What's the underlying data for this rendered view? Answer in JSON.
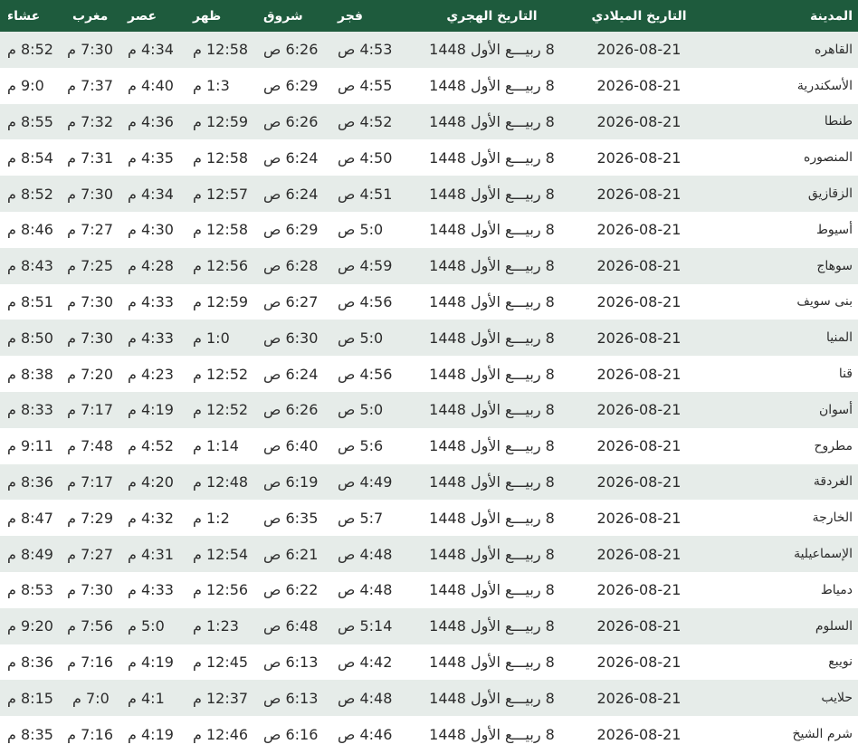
{
  "table": {
    "headers": {
      "city": "المدينة",
      "gregorian": "التاريخ الميلادي",
      "hijri": "التاريخ الهجري",
      "fajr": "فجر",
      "shuruq": "شروق",
      "dhuhr": "ظهر",
      "asr": "عصر",
      "maghrib": "مغرب",
      "isha": "عشاء"
    },
    "rows": [
      {
        "city": "القاهره",
        "gregorian": "2026-08-21",
        "hijri": "8 ربيـــع الأول 1448",
        "fajr": "4:53 ص",
        "shuruq": "6:26 ص",
        "dhuhr": "12:58 م",
        "asr": "4:34 م",
        "maghrib": "7:30 م",
        "isha": "8:52 م"
      },
      {
        "city": "الأسكندرية",
        "gregorian": "2026-08-21",
        "hijri": "8 ربيـــع الأول 1448",
        "fajr": "4:55 ص",
        "shuruq": "6:29 ص",
        "dhuhr": "1:3 م",
        "asr": "4:40 م",
        "maghrib": "7:37 م",
        "isha": "9:0 م"
      },
      {
        "city": "طنطا",
        "gregorian": "2026-08-21",
        "hijri": "8 ربيـــع الأول 1448",
        "fajr": "4:52 ص",
        "shuruq": "6:26 ص",
        "dhuhr": "12:59 م",
        "asr": "4:36 م",
        "maghrib": "7:32 م",
        "isha": "8:55 م"
      },
      {
        "city": "المنصوره",
        "gregorian": "2026-08-21",
        "hijri": "8 ربيـــع الأول 1448",
        "fajr": "4:50 ص",
        "shuruq": "6:24 ص",
        "dhuhr": "12:58 م",
        "asr": "4:35 م",
        "maghrib": "7:31 م",
        "isha": "8:54 م"
      },
      {
        "city": "الزقازيق",
        "gregorian": "2026-08-21",
        "hijri": "8 ربيـــع الأول 1448",
        "fajr": "4:51 ص",
        "shuruq": "6:24 ص",
        "dhuhr": "12:57 م",
        "asr": "4:34 م",
        "maghrib": "7:30 م",
        "isha": "8:52 م"
      },
      {
        "city": "أسيوط",
        "gregorian": "2026-08-21",
        "hijri": "8 ربيـــع الأول 1448",
        "fajr": "5:0 ص",
        "shuruq": "6:29 ص",
        "dhuhr": "12:58 م",
        "asr": "4:30 م",
        "maghrib": "7:27 م",
        "isha": "8:46 م"
      },
      {
        "city": "سوهاج",
        "gregorian": "2026-08-21",
        "hijri": "8 ربيـــع الأول 1448",
        "fajr": "4:59 ص",
        "shuruq": "6:28 ص",
        "dhuhr": "12:56 م",
        "asr": "4:28 م",
        "maghrib": "7:25 م",
        "isha": "8:43 م"
      },
      {
        "city": "بنى سويف",
        "gregorian": "2026-08-21",
        "hijri": "8 ربيـــع الأول 1448",
        "fajr": "4:56 ص",
        "shuruq": "6:27 ص",
        "dhuhr": "12:59 م",
        "asr": "4:33 م",
        "maghrib": "7:30 م",
        "isha": "8:51 م"
      },
      {
        "city": "المنيا",
        "gregorian": "2026-08-21",
        "hijri": "8 ربيـــع الأول 1448",
        "fajr": "5:0 ص",
        "shuruq": "6:30 ص",
        "dhuhr": "1:0 م",
        "asr": "4:33 م",
        "maghrib": "7:30 م",
        "isha": "8:50 م"
      },
      {
        "city": "قنا",
        "gregorian": "2026-08-21",
        "hijri": "8 ربيـــع الأول 1448",
        "fajr": "4:56 ص",
        "shuruq": "6:24 ص",
        "dhuhr": "12:52 م",
        "asr": "4:23 م",
        "maghrib": "7:20 م",
        "isha": "8:38 م"
      },
      {
        "city": "أسوان",
        "gregorian": "2026-08-21",
        "hijri": "8 ربيـــع الأول 1448",
        "fajr": "5:0 ص",
        "shuruq": "6:26 ص",
        "dhuhr": "12:52 م",
        "asr": "4:19 م",
        "maghrib": "7:17 م",
        "isha": "8:33 م"
      },
      {
        "city": "مطروح",
        "gregorian": "2026-08-21",
        "hijri": "8 ربيـــع الأول 1448",
        "fajr": "5:6 ص",
        "shuruq": "6:40 ص",
        "dhuhr": "1:14 م",
        "asr": "4:52 م",
        "maghrib": "7:48 م",
        "isha": "9:11 م"
      },
      {
        "city": "الغردقة",
        "gregorian": "2026-08-21",
        "hijri": "8 ربيـــع الأول 1448",
        "fajr": "4:49 ص",
        "shuruq": "6:19 ص",
        "dhuhr": "12:48 م",
        "asr": "4:20 م",
        "maghrib": "7:17 م",
        "isha": "8:36 م"
      },
      {
        "city": "الخارجة",
        "gregorian": "2026-08-21",
        "hijri": "8 ربيـــع الأول 1448",
        "fajr": "5:7 ص",
        "shuruq": "6:35 ص",
        "dhuhr": "1:2 م",
        "asr": "4:32 م",
        "maghrib": "7:29 م",
        "isha": "8:47 م"
      },
      {
        "city": "الإسماعيلية",
        "gregorian": "2026-08-21",
        "hijri": "8 ربيـــع الأول 1448",
        "fajr": "4:48 ص",
        "shuruq": "6:21 ص",
        "dhuhr": "12:54 م",
        "asr": "4:31 م",
        "maghrib": "7:27 م",
        "isha": "8:49 م"
      },
      {
        "city": "دمياط",
        "gregorian": "2026-08-21",
        "hijri": "8 ربيـــع الأول 1448",
        "fajr": "4:48 ص",
        "shuruq": "6:22 ص",
        "dhuhr": "12:56 م",
        "asr": "4:33 م",
        "maghrib": "7:30 م",
        "isha": "8:53 م"
      },
      {
        "city": "السلوم",
        "gregorian": "2026-08-21",
        "hijri": "8 ربيـــع الأول 1448",
        "fajr": "5:14 ص",
        "shuruq": "6:48 ص",
        "dhuhr": "1:23 م",
        "asr": "5:0 م",
        "maghrib": "7:56 م",
        "isha": "9:20 م"
      },
      {
        "city": "نويبع",
        "gregorian": "2026-08-21",
        "hijri": "8 ربيـــع الأول 1448",
        "fajr": "4:42 ص",
        "shuruq": "6:13 ص",
        "dhuhr": "12:45 م",
        "asr": "4:19 م",
        "maghrib": "7:16 م",
        "isha": "8:36 م"
      },
      {
        "city": "حلايب",
        "gregorian": "2026-08-21",
        "hijri": "8 ربيـــع الأول 1448",
        "fajr": "4:48 ص",
        "shuruq": "6:13 ص",
        "dhuhr": "12:37 م",
        "asr": "4:1 م",
        "maghrib": "7:0 م",
        "isha": "8:15 م"
      },
      {
        "city": "شرم الشيخ",
        "gregorian": "2026-08-21",
        "hijri": "8 ربيـــع الأول 1448",
        "fajr": "4:46 ص",
        "shuruq": "6:16 ص",
        "dhuhr": "12:46 م",
        "asr": "4:19 م",
        "maghrib": "7:16 م",
        "isha": "8:35 م"
      }
    ]
  }
}
